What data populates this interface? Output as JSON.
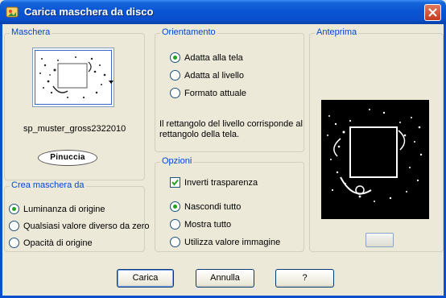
{
  "window": {
    "title": "Carica maschera da disco"
  },
  "mask_group": {
    "label": "Maschera",
    "mask_name": "sp_muster_gross2322010",
    "logo_text": "Pinuccia"
  },
  "create_group": {
    "label": "Crea maschera da",
    "options": [
      {
        "label": "Luminanza di origine",
        "selected": true
      },
      {
        "label": "Qualsiasi valore diverso da zero",
        "selected": false
      },
      {
        "label": "Opacità di origine",
        "selected": false
      }
    ]
  },
  "orientation_group": {
    "label": "Orientamento",
    "options": [
      {
        "label": "Adatta alla tela",
        "selected": true
      },
      {
        "label": "Adatta al livello",
        "selected": false
      },
      {
        "label": "Formato attuale",
        "selected": false
      }
    ],
    "info": "Il rettangolo del livello corrisponde al rettangolo della tela."
  },
  "options_group": {
    "label": "Opzioni",
    "invert_label": "Inverti trasparenza",
    "invert_checked": true,
    "options": [
      {
        "label": "Nascondi tutto",
        "selected": true
      },
      {
        "label": "Mostra tutto",
        "selected": false
      },
      {
        "label": "Utilizza valore immagine",
        "selected": false
      }
    ]
  },
  "preview_group": {
    "label": "Anteprima"
  },
  "buttons": {
    "load": "Carica",
    "cancel": "Annulla",
    "help": "?"
  },
  "colors": {
    "title_bar": "#0a4fcd",
    "group_label": "#0046d5",
    "radio_dot": "#21a121"
  },
  "icons": {
    "app": "mask-app-icon",
    "close": "close-icon"
  }
}
